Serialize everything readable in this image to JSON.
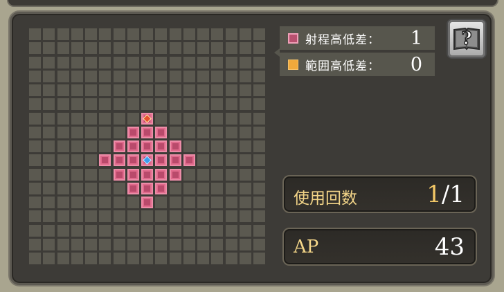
{
  "legend": {
    "range_height_label": "射程高低差：",
    "range_height_value": "1",
    "area_height_label": "範囲高低差：",
    "area_height_value": "0",
    "colors": {
      "range": "#e06a8c",
      "area": "#f0a93b"
    }
  },
  "help": {
    "icon": "question-book-icon",
    "glyph": "?"
  },
  "uses": {
    "label": "使用回数",
    "current": "1",
    "separator": "/",
    "max": "1"
  },
  "ap": {
    "label": "AP",
    "value": "43"
  },
  "grid": {
    "columns": 17,
    "rows": 17,
    "range_cells": [
      [
        8,
        6
      ],
      [
        7,
        7
      ],
      [
        8,
        7
      ],
      [
        9,
        7
      ],
      [
        6,
        8
      ],
      [
        7,
        8
      ],
      [
        8,
        8
      ],
      [
        9,
        8
      ],
      [
        10,
        8
      ],
      [
        5,
        9
      ],
      [
        6,
        9
      ],
      [
        7,
        9
      ],
      [
        8,
        9
      ],
      [
        9,
        9
      ],
      [
        10,
        9
      ],
      [
        11,
        9
      ],
      [
        6,
        10
      ],
      [
        7,
        10
      ],
      [
        8,
        10
      ],
      [
        9,
        10
      ],
      [
        10,
        10
      ],
      [
        7,
        11
      ],
      [
        8,
        11
      ],
      [
        9,
        11
      ],
      [
        8,
        12
      ]
    ],
    "target_cell": [
      8,
      6
    ],
    "self_cell": [
      8,
      9
    ]
  }
}
